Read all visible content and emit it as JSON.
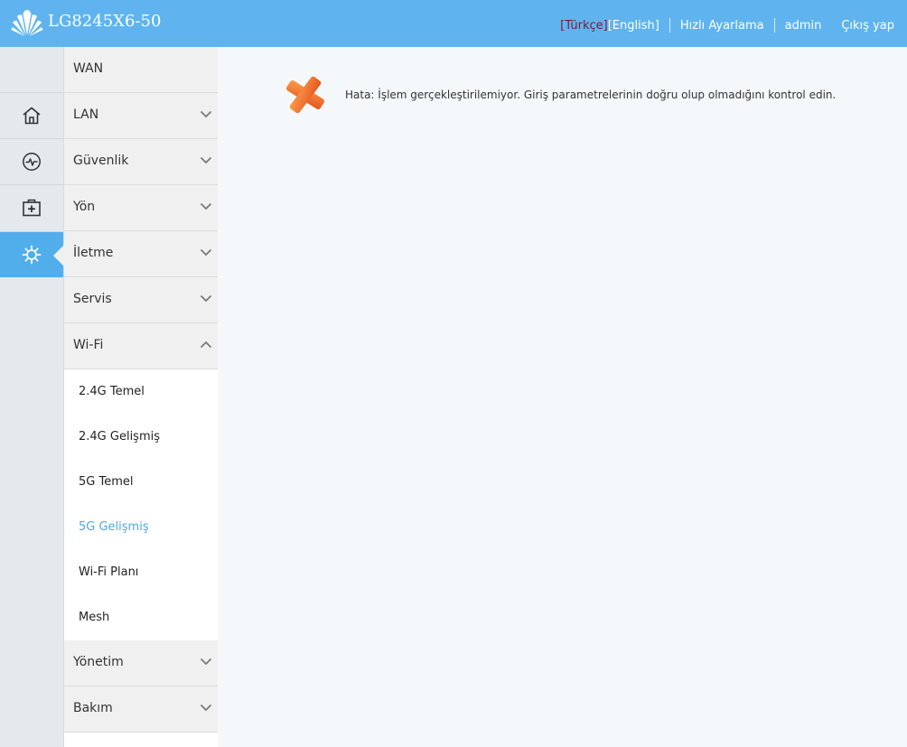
{
  "header": {
    "device_name": "LG8245X6-50",
    "lang_turkish": "[Türkçe]",
    "lang_english": "[English]",
    "quick_setup": "Hızlı Ayarlama",
    "user": "admin",
    "logout": "Çıkış yap",
    "bg_color": "#5fb4ef"
  },
  "icon_nav": [
    {
      "icon": "home-icon"
    },
    {
      "icon": "status-monitor-icon"
    },
    {
      "icon": "add-box-icon"
    },
    {
      "icon": "settings-gear-icon",
      "active": true
    }
  ],
  "menu": {
    "items": [
      {
        "label": "WAN"
      },
      {
        "label": "LAN"
      },
      {
        "label": "Güvenlik"
      },
      {
        "label": "Yön"
      },
      {
        "label": "İletme"
      },
      {
        "label": "Servis"
      },
      {
        "label": "Wi-Fi",
        "expanded": true
      },
      {
        "label": "Yönetim"
      },
      {
        "label": "Bakım"
      }
    ],
    "wifi_sub": [
      {
        "label": "2.4G Temel"
      },
      {
        "label": "2.4G Gelişmiş"
      },
      {
        "label": "5G Temel"
      },
      {
        "label": "5G Gelişmiş",
        "active": true
      },
      {
        "label": "Wi-Fi Planı"
      },
      {
        "label": "Mesh"
      }
    ],
    "active_color": "#4da8e0"
  },
  "content": {
    "error_message": "Hata: İşlem gerçekleştirilemiyor. Giriş parametrelerinin doğru olup olmadığını kontrol edin.",
    "error_icon": "error-x-icon"
  }
}
